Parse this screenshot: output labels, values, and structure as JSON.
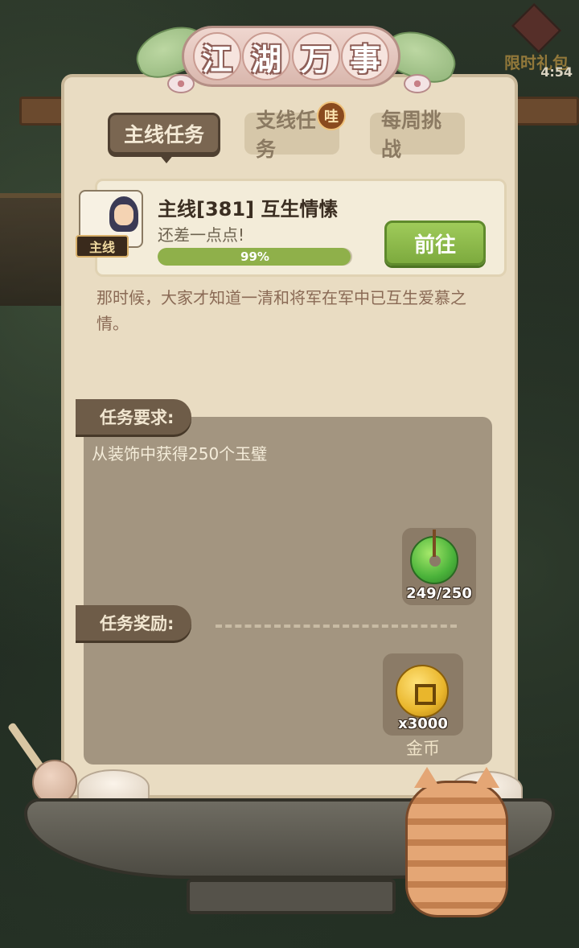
{
  "header": {
    "title_chars": [
      "江",
      "湖",
      "万",
      "事"
    ]
  },
  "timed_gift": {
    "label": "限时礼包",
    "timer": "4:54"
  },
  "tabs": [
    {
      "label": "主线任务",
      "active": true
    },
    {
      "label": "支线任务",
      "active": false,
      "badge": "哇"
    },
    {
      "label": "每周挑战",
      "active": false
    }
  ],
  "quest": {
    "tag": "主线",
    "title": "主线[381]  互生情愫",
    "subtitle": "还差一点点!",
    "progress_percent": 99,
    "progress_label": "99%",
    "go_button": "前往",
    "description": "那时候，大家才知道一清和将军在军中已互生爱慕之情。"
  },
  "requirements": {
    "label": "任务要求:",
    "text": "从装饰中获得250个玉璧",
    "item": {
      "icon": "jade-bi-icon",
      "count": "249/250"
    }
  },
  "rewards": {
    "label": "任务奖励:",
    "item": {
      "icon": "gold-coin-icon",
      "count": "x3000",
      "name": "金币"
    }
  },
  "colors": {
    "panel": "#e9dcc2",
    "accent_green": "#8fb04a",
    "tab_active": "#7a6651"
  }
}
